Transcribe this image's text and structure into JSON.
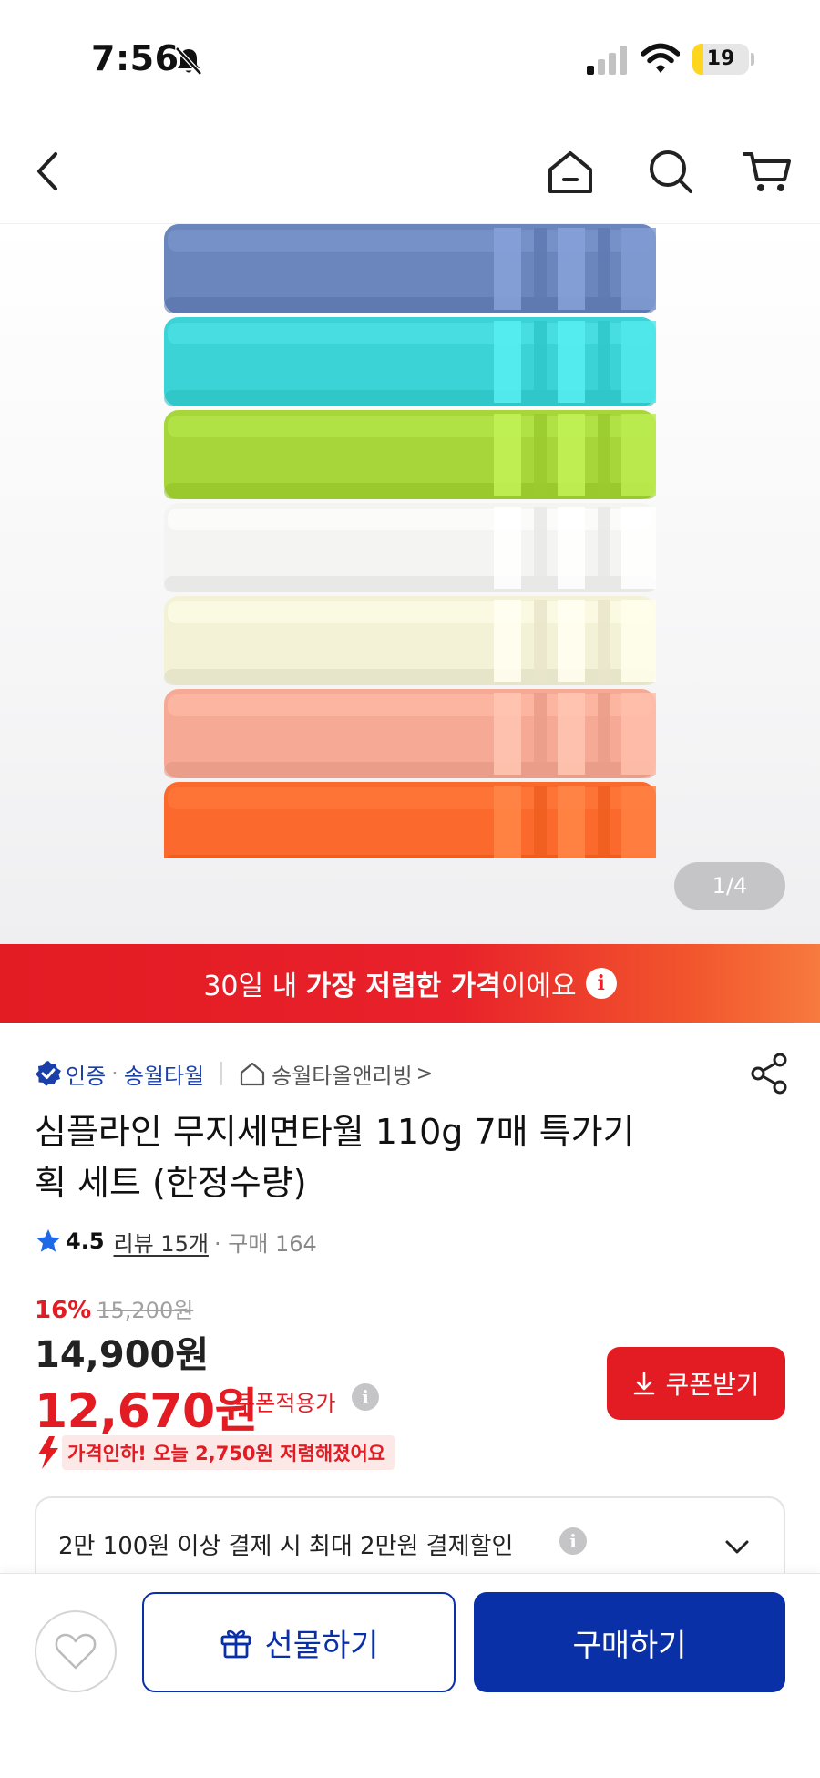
{
  "status_bar": {
    "time": "7:56",
    "battery_level": "19",
    "battery_fraction": 0.19
  },
  "nav": {
    "back_icon": "chevron-left-icon",
    "home_icon": "home-icon",
    "search_icon": "search-icon",
    "cart_icon": "cart-icon"
  },
  "gallery": {
    "current": "1",
    "separator": "/",
    "total": "4",
    "towel_colors": [
      "#6b86bd",
      "#3cd3d6",
      "#a6d63a",
      "#f4f5f2",
      "#f3f1d6",
      "#f6aa96",
      "#fb6a2c"
    ]
  },
  "banner": {
    "part1": "30일 내 ",
    "part2_strong": "가장 저렴한 가격",
    "part3": "이에요",
    "info_glyph": "i"
  },
  "seller": {
    "verified_label": "인증",
    "dot": "·",
    "name": "송월타월",
    "store_link": "송월타올앤리빙",
    "store_chevron": ">"
  },
  "product": {
    "title_line1": "심플라인 무지세면타월 110g 7매 특가기",
    "title_line2": "획 세트 (한정수량)"
  },
  "rating": {
    "value": "4.5",
    "reviews": "리뷰 15개",
    "purchases": "· 구매 164"
  },
  "price": {
    "discount_rate": "16%",
    "original": "15,200원",
    "sale": "14,900원",
    "coupon_price": "12,670원",
    "coupon_label": "쿠폰적용가",
    "info_glyph": "i",
    "coupon_button": "쿠폰받기",
    "price_drop": "가격인하! 오늘 2,750원 저렴해졌어요"
  },
  "card_discount": {
    "text": "2만 100원 이상 결제 시 최대 2만원 결제할인",
    "info_glyph": "i"
  },
  "actions": {
    "gift": "선물하기",
    "buy": "구매하기"
  },
  "colors": {
    "brand_blue": "#0a30a8",
    "accent_red": "#e31b23"
  }
}
